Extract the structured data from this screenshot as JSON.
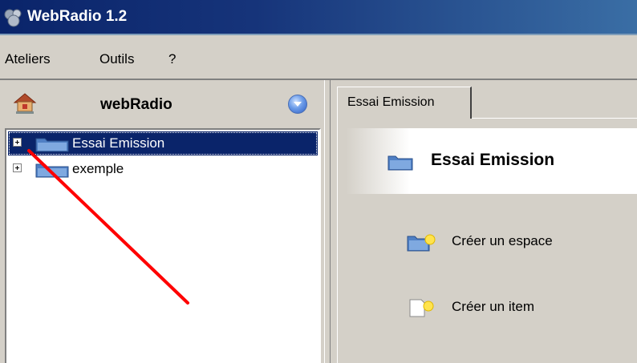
{
  "window": {
    "title": "WebRadio 1.2"
  },
  "menu": [
    {
      "label": "Ateliers"
    },
    {
      "label": "Outils"
    },
    {
      "label": "?"
    }
  ],
  "left_panel": {
    "title": "webRadio",
    "tree": [
      {
        "label": "Essai Emission",
        "selected": true
      },
      {
        "label": "exemple",
        "selected": false
      }
    ]
  },
  "right_panel": {
    "tab_label": "Essai Emission",
    "banner_title": "Essai Emission",
    "actions": [
      {
        "label": "Créer un espace"
      },
      {
        "label": "Créer un item"
      }
    ]
  },
  "colors": {
    "selection": "#0a246a",
    "annotation_arrow": "#ff0000",
    "title_bar": "#0a246a"
  }
}
